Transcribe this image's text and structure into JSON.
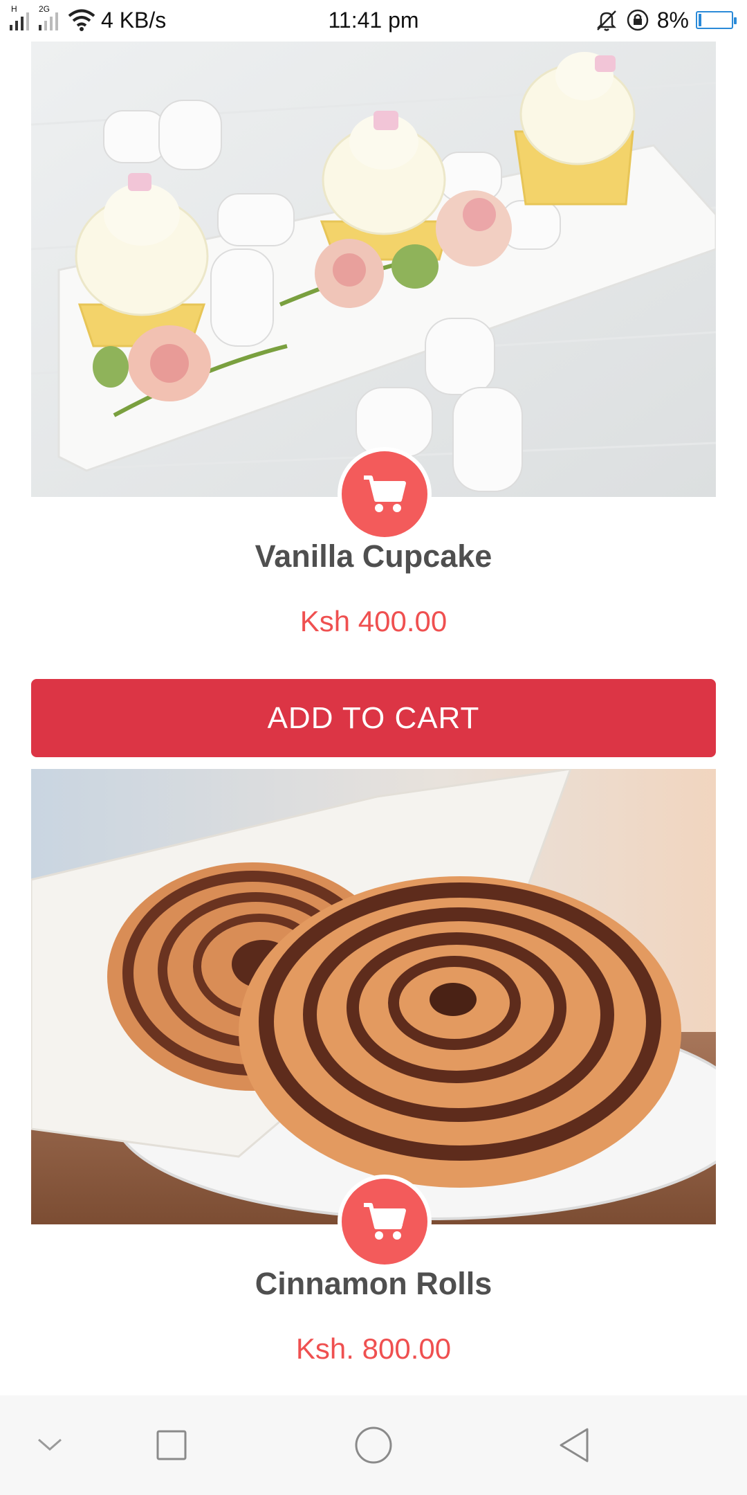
{
  "status_bar": {
    "network_type": "2G",
    "network_small": "H",
    "speed": "4 KB/s",
    "time": "11:41 pm",
    "battery_percent_text": "8%",
    "battery_level": 0.08
  },
  "products": [
    {
      "name": "Vanilla Cupcake",
      "price": "Ksh 400.00",
      "button_label": "ADD TO CART",
      "image_icon": "cupcake-photo"
    },
    {
      "name": "Cinnamon Rolls",
      "price": "Ksh. 800.00",
      "image_icon": "cinnamon-roll-photo"
    }
  ],
  "nav": {
    "icons": [
      "chevron-down-icon",
      "recent-apps-icon",
      "home-icon",
      "back-icon"
    ]
  },
  "colors": {
    "accent_red": "#f35b5b",
    "button_red": "#dc3545",
    "price_red": "#ef5050"
  }
}
